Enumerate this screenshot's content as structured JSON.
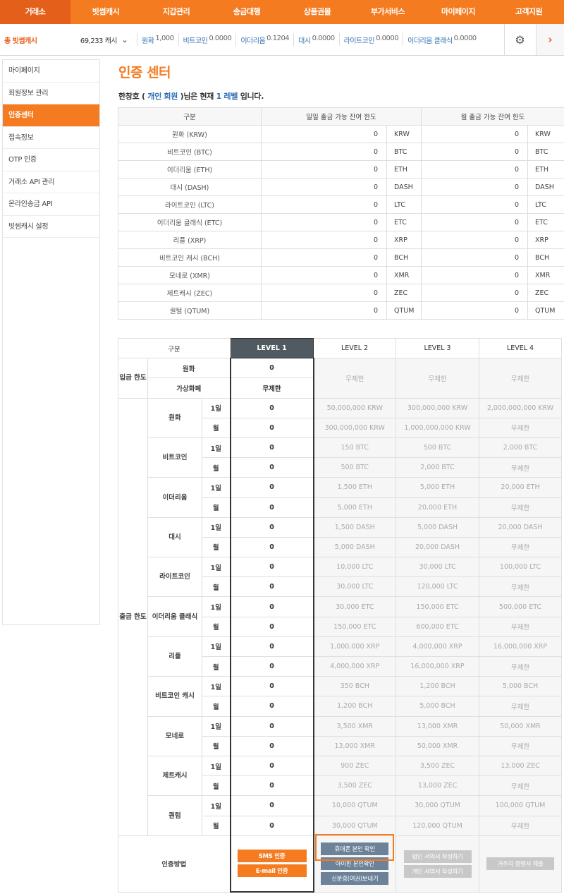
{
  "topnav": [
    "거래소",
    "빗썸캐시",
    "지갑관리",
    "송금대행",
    "상품권몰",
    "부가서비스",
    "마이페이지",
    "고객지원"
  ],
  "balance_bar": {
    "total_label": "총 빗썸캐시",
    "total_value": "69,233 캐시",
    "coins": [
      {
        "name": "원화",
        "value": "1,000"
      },
      {
        "name": "비트코인",
        "value": "0.0000"
      },
      {
        "name": "이더리움",
        "value": "0.1204"
      },
      {
        "name": "대시",
        "value": "0.0000"
      },
      {
        "name": "라이트코인",
        "value": "0.0000"
      },
      {
        "name": "이더리움 클래식",
        "value": "0.0000"
      }
    ]
  },
  "sidebar": [
    "마이페이지",
    "회원정보 관리",
    "인증센터",
    "접속정보",
    "OTP 인증",
    "거래소 API 관리",
    "온라인송금 API",
    "빗썸캐시 설정"
  ],
  "page": {
    "title": "인증 센터",
    "level_line": {
      "name": "한창호 (",
      "member": "개인 회원",
      "mid": ")님은 현재",
      "level": "1 레벨",
      "end": "입니다."
    }
  },
  "limits_table": {
    "headers": [
      "구분",
      "일일 출금 가능 잔여 한도",
      "월 출금 가능 잔여 한도"
    ],
    "rows": [
      {
        "name": "원화 (KRW)",
        "daily": "0",
        "unit": "KRW",
        "monthly": "0"
      },
      {
        "name": "비트코인 (BTC)",
        "daily": "0",
        "unit": "BTC",
        "monthly": "0"
      },
      {
        "name": "이더리움 (ETH)",
        "daily": "0",
        "unit": "ETH",
        "monthly": "0"
      },
      {
        "name": "대시 (DASH)",
        "daily": "0",
        "unit": "DASH",
        "monthly": "0"
      },
      {
        "name": "라이트코인 (LTC)",
        "daily": "0",
        "unit": "LTC",
        "monthly": "0"
      },
      {
        "name": "이더리움 클래식 (ETC)",
        "daily": "0",
        "unit": "ETC",
        "monthly": "0"
      },
      {
        "name": "리플 (XRP)",
        "daily": "0",
        "unit": "XRP",
        "monthly": "0"
      },
      {
        "name": "비트코인 캐시 (BCH)",
        "daily": "0",
        "unit": "BCH",
        "monthly": "0"
      },
      {
        "name": "모네로 (XMR)",
        "daily": "0",
        "unit": "XMR",
        "monthly": "0"
      },
      {
        "name": "제트캐시 (ZEC)",
        "daily": "0",
        "unit": "ZEC",
        "monthly": "0"
      },
      {
        "name": "퀀텀 (QTUM)",
        "daily": "0",
        "unit": "QTUM",
        "monthly": "0"
      }
    ]
  },
  "levels_table": {
    "header": [
      "구분",
      "LEVEL 1",
      "LEVEL 2",
      "LEVEL 3",
      "LEVEL 4"
    ],
    "deposit": {
      "label": "입금 한도",
      "rows": [
        {
          "name": "원화",
          "l1": "0"
        },
        {
          "name": "가상화폐",
          "l1": "무제한"
        }
      ],
      "l2": "무제한",
      "l3": "무제한",
      "l4": "무제한"
    },
    "withdraw_label": "출금 한도",
    "day_label": "1일",
    "month_label": "월",
    "coins": [
      {
        "name": "원화",
        "l1d": "0",
        "l1m": "0",
        "l2d": "50,000,000 KRW",
        "l2m": "300,000,000 KRW",
        "l3d": "300,000,000 KRW",
        "l3m": "1,000,000,000 KRW",
        "l4d": "2,000,000,000 KRW",
        "l4m": "무제한"
      },
      {
        "name": "비트코인",
        "l1d": "0",
        "l1m": "0",
        "l2d": "150 BTC",
        "l2m": "500 BTC",
        "l3d": "500 BTC",
        "l3m": "2,000 BTC",
        "l4d": "2,000 BTC",
        "l4m": "무제한"
      },
      {
        "name": "이더리움",
        "l1d": "0",
        "l1m": "0",
        "l2d": "1,500 ETH",
        "l2m": "5,000 ETH",
        "l3d": "5,000 ETH",
        "l3m": "20,000 ETH",
        "l4d": "20,000 ETH",
        "l4m": "무제한"
      },
      {
        "name": "대시",
        "l1d": "0",
        "l1m": "0",
        "l2d": "1,500 DASH",
        "l2m": "5,000 DASH",
        "l3d": "5,000 DASH",
        "l3m": "20,000 DASH",
        "l4d": "20,000 DASH",
        "l4m": "무제한"
      },
      {
        "name": "라이트코인",
        "l1d": "0",
        "l1m": "0",
        "l2d": "10,000 LTC",
        "l2m": "30,000 LTC",
        "l3d": "30,000 LTC",
        "l3m": "120,000 LTC",
        "l4d": "100,000 LTC",
        "l4m": "무제한"
      },
      {
        "name": "이더리움 클래식",
        "l1d": "0",
        "l1m": "0",
        "l2d": "30,000 ETC",
        "l2m": "150,000 ETC",
        "l3d": "150,000 ETC",
        "l3m": "600,000 ETC",
        "l4d": "500,000 ETC",
        "l4m": "무제한"
      },
      {
        "name": "리플",
        "l1d": "0",
        "l1m": "0",
        "l2d": "1,000,000 XRP",
        "l2m": "4,000,000 XRP",
        "l3d": "4,000,000 XRP",
        "l3m": "16,000,000 XRP",
        "l4d": "16,000,000 XRP",
        "l4m": "무제한"
      },
      {
        "name": "비트코인 캐시",
        "l1d": "0",
        "l1m": "0",
        "l2d": "350 BCH",
        "l2m": "1,200 BCH",
        "l3d": "1,200 BCH",
        "l3m": "5,000 BCH",
        "l4d": "5,000 BCH",
        "l4m": "무제한"
      },
      {
        "name": "모네로",
        "l1d": "0",
        "l1m": "0",
        "l2d": "3,500 XMR",
        "l2m": "13,000 XMR",
        "l3d": "13,000 XMR",
        "l3m": "50,000 XMR",
        "l4d": "50,000 XMR",
        "l4m": "무제한"
      },
      {
        "name": "제트캐시",
        "l1d": "0",
        "l1m": "0",
        "l2d": "900 ZEC",
        "l2m": "3,500 ZEC",
        "l3d": "3,500 ZEC",
        "l3m": "13,000 ZEC",
        "l4d": "13,000 ZEC",
        "l4m": "무제한"
      },
      {
        "name": "퀀텀",
        "l1d": "0",
        "l1m": "0",
        "l2d": "10,000 QTUM",
        "l2m": "30,000 QTUM",
        "l3d": "30,000 QTUM",
        "l3m": "120,000 QTUM",
        "l4d": "100,000 QTUM",
        "l4m": "무제한"
      }
    ],
    "auth": {
      "label": "인증방법",
      "l1": [
        "SMS 인증",
        "E-mail 인증"
      ],
      "l2": [
        "휴대폰 본인 확인",
        "아이핀 본인확인",
        "신분증(여권)보내기"
      ],
      "l3": [
        "법인 서약서 작성하기",
        "개인 서약서 작성하기"
      ],
      "l4": [
        "거주지 증명서 제출"
      ]
    }
  },
  "colors": {
    "accent": "#f47b20",
    "level1_header": "#525a61",
    "link": "#2f6fb3",
    "steel_button": "#6b8299"
  }
}
